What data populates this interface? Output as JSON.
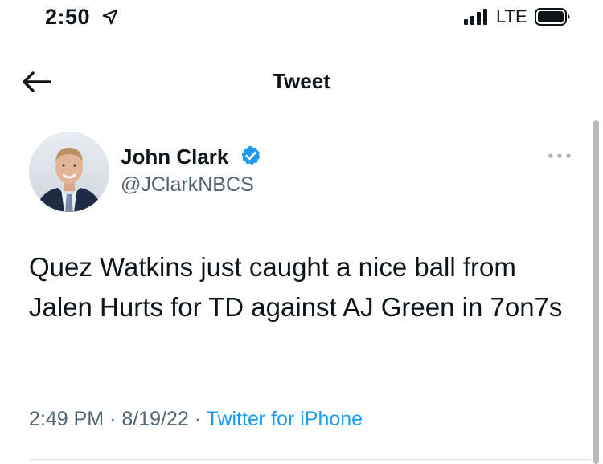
{
  "status_bar": {
    "time": "2:50",
    "network": "LTE",
    "icons": [
      "location-arrow-icon",
      "signal-bars-icon",
      "battery-icon"
    ]
  },
  "header": {
    "title": "Tweet",
    "back_icon": "arrow-left-icon"
  },
  "tweet": {
    "author": {
      "name": "John Clark",
      "handle": "@JClarkNBCS",
      "verified_icon": "verified-badge-icon"
    },
    "more_icon": "more-horizontal-icon",
    "text": "Quez Watkins just caught a nice ball from Jalen Hurts for TD against AJ Green in 7on7s",
    "time": "2:49 PM",
    "separator": "·",
    "date": "8/19/22",
    "source": "Twitter for iPhone"
  },
  "colors": {
    "accent": "#1d9bf0",
    "secondary_text": "#536471",
    "primary_text": "#0f1419"
  }
}
